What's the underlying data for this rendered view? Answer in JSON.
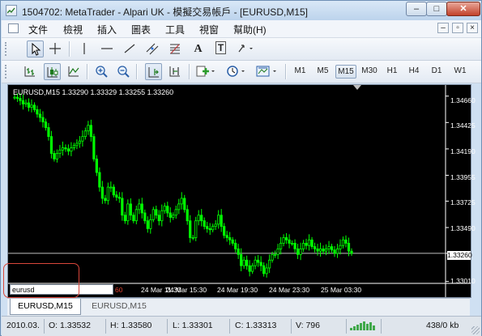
{
  "window": {
    "title": "1504702: MetaTrader - Alpari UK - 模擬交易帳戶 - [EURUSD,M15]",
    "controls": {
      "minimize": "–",
      "maximize": "□",
      "close": "✕"
    }
  },
  "menu": {
    "items": [
      "文件",
      "檢視",
      "插入",
      "圖表",
      "工具",
      "視窗",
      "幫助(H)"
    ],
    "mdi_controls": {
      "minimize": "–",
      "restore": "▫",
      "close": "×"
    }
  },
  "toolbar1": {
    "buttons": [
      "cursor",
      "crosshair",
      "vertical-line",
      "horizontal-line",
      "trendline",
      "equidistant-channel",
      "fibonacci",
      "text",
      "text-label",
      "arrows"
    ],
    "labels": {
      "text": "A",
      "text_label": "T"
    }
  },
  "toolbar2": {
    "buttons": [
      "bar-chart",
      "candlesticks",
      "line-chart",
      "zoom-in",
      "zoom-out",
      "chart-shift",
      "autoscroll",
      "indicators",
      "periods",
      "templates"
    ],
    "timeframes": [
      "M1",
      "M5",
      "M15",
      "M30",
      "H1",
      "H4",
      "D1",
      "W1"
    ],
    "active_timeframe": "M15"
  },
  "chart": {
    "header": "EURUSD,M15  1.33290 1.33329 1.33255 1.33260",
    "current_price": "1.33260",
    "navigator_input": "eurusd",
    "partial_label": "60",
    "colors": {
      "background": "#000000",
      "candles": "#00ff00",
      "text": "#ffffff",
      "bid_line": "#c0c0c0"
    }
  },
  "chart_data": {
    "type": "candlestick",
    "symbol": "EURUSD",
    "timeframe": "M15",
    "yaxis_ticks": [
      "1.34660",
      "1.34425",
      "1.34190",
      "1.33955",
      "1.33725",
      "1.33490",
      "1.33260",
      "1.33010"
    ],
    "xaxis_ticks": [
      "24 Mar 11:30",
      "24 Mar 15:30",
      "24 Mar 19:30",
      "24 Mar 23:30",
      "25 Mar 03:30"
    ],
    "ylim": [
      1.33,
      1.3473
    ],
    "last_bar": {
      "open": 1.3329,
      "high": 1.33329,
      "low": 1.33255,
      "close": 1.3326
    },
    "closes": [
      1.3465,
      1.3464,
      1.3462,
      1.3459,
      1.346,
      1.3456,
      1.3458,
      1.3454,
      1.345,
      1.3447,
      1.3443,
      1.3438,
      1.343,
      1.3415,
      1.341,
      1.3415,
      1.3418,
      1.342,
      1.3419,
      1.3417,
      1.342,
      1.3422,
      1.3424,
      1.3426,
      1.343,
      1.3435,
      1.344,
      1.343,
      1.341,
      1.3398,
      1.3385,
      1.3375,
      1.3373,
      1.3385,
      1.3385,
      1.3378,
      1.3376,
      1.3375,
      1.336,
      1.3355,
      1.337,
      1.336,
      1.3355,
      1.3365,
      1.337,
      1.3362,
      1.3355,
      1.3348,
      1.3356,
      1.3365,
      1.336,
      1.3355,
      1.3364,
      1.3368,
      1.3362,
      1.3358,
      1.336,
      1.3365,
      1.337,
      1.3375,
      1.3365,
      1.3355,
      1.334,
      1.334,
      1.3355,
      1.336,
      1.3355,
      1.335,
      1.3348,
      1.3347,
      1.335,
      1.3352,
      1.336,
      1.335,
      1.3342,
      1.334,
      1.3338,
      1.3335,
      1.333,
      1.3325,
      1.3315,
      1.332,
      1.3315,
      1.331,
      1.3315,
      1.332,
      1.3318,
      1.3315,
      1.3308,
      1.3313,
      1.332,
      1.3325,
      1.3325,
      1.333,
      1.3335,
      1.334,
      1.3338,
      1.3335,
      1.3335,
      1.333,
      1.3325,
      1.333,
      1.3335,
      1.3333,
      1.3338,
      1.3332,
      1.333,
      1.3328,
      1.333,
      1.3328,
      1.333,
      1.3332,
      1.3329,
      1.3326,
      1.333,
      1.3333,
      1.3338,
      1.3335,
      1.3328,
      1.3326
    ]
  },
  "tabs": [
    "EURUSD,M15",
    "EURUSD,M15"
  ],
  "active_tab": 0,
  "status": {
    "datetime": "2010.03.",
    "open": "O: 1.33532",
    "high": "H: 1.33580",
    "low": "L: 1.33301",
    "close": "C: 1.33313",
    "volume": "V: 796",
    "traffic": "438/0 kb"
  }
}
